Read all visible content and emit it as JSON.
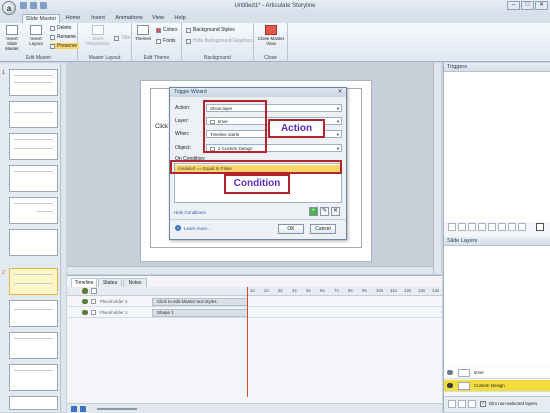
{
  "window": {
    "title": "Untitled1* - Articulate Storyline",
    "app_icon": "a",
    "controls": [
      "–",
      "□",
      "✕"
    ]
  },
  "ribbon": {
    "tabs": [
      "Slide Master",
      "Home",
      "Insert",
      "Animations",
      "View",
      "Help"
    ],
    "active_tab": "Slide Master",
    "groups": {
      "edit_master": {
        "label": "Edit Master",
        "insert_slide_master": "Insert Slide Master",
        "insert_layout": "Insert Layout",
        "delete": "Delete",
        "rename": "Rename",
        "preserve": "Preserve"
      },
      "master_layout": {
        "label": "Master Layout",
        "insert_placeholder": "Insert Placeholder",
        "title": "Title"
      },
      "edit_theme": {
        "label": "Edit Theme",
        "themes": "Themes",
        "colors": "Colors",
        "fonts": "Fonts"
      },
      "background": {
        "label": "Background",
        "background_styles": "Background Styles",
        "hide_background_graphics": "Hide Background Graphics"
      },
      "close": {
        "label": "Close",
        "close_master_view": "Close Master View"
      }
    }
  },
  "left_panel": {
    "numbers": [
      "1",
      "2"
    ]
  },
  "slide": {
    "placeholder_text": "Click"
  },
  "dialog": {
    "title": "Trigger Wizard",
    "close": "✕",
    "action_label": "Action:",
    "action_value": "Show layer",
    "layer_label": "Layer:",
    "layer_value": "timer",
    "when_label": "When:",
    "when_value": "Timeline starts",
    "object_label": "Object:",
    "object_value": "2 Custom Design",
    "on_condition_label": "On Condition:",
    "condition_row": "module2 == Equal to False",
    "hide_conditions": "Hide Conditions",
    "learn_more": "Learn more...",
    "ok": "OK",
    "cancel": "Cancel"
  },
  "annotations": {
    "action": "Action",
    "condition": "Condition",
    "color": "#b3242d"
  },
  "timeline": {
    "tabs": [
      "Timeline",
      "States",
      "Notes"
    ],
    "active_tab": "Timeline",
    "ruler": [
      "1s",
      "2s",
      "3s",
      "4s",
      "5s",
      "6s",
      "7s",
      "8s",
      "9s",
      "10s",
      "11s",
      "12s",
      "13s",
      "14s",
      "15s"
    ],
    "rows": [
      {
        "name": "Placeholder 2",
        "bar": "Click to edit Master text styles"
      },
      {
        "name": "Placeholder 1",
        "bar": "Shape 1"
      }
    ]
  },
  "right_panel": {
    "triggers_title": "Triggers",
    "slide_layers_title": "Slide Layers",
    "layers": [
      {
        "name": "timer"
      },
      {
        "name": "Custom Design"
      }
    ],
    "dim_label": "Dim non-selected layers"
  },
  "colors": {
    "highlight": "#fbd76a",
    "selected_layer": "#f4dc3c",
    "annotation_text": "#5b2fb8"
  }
}
